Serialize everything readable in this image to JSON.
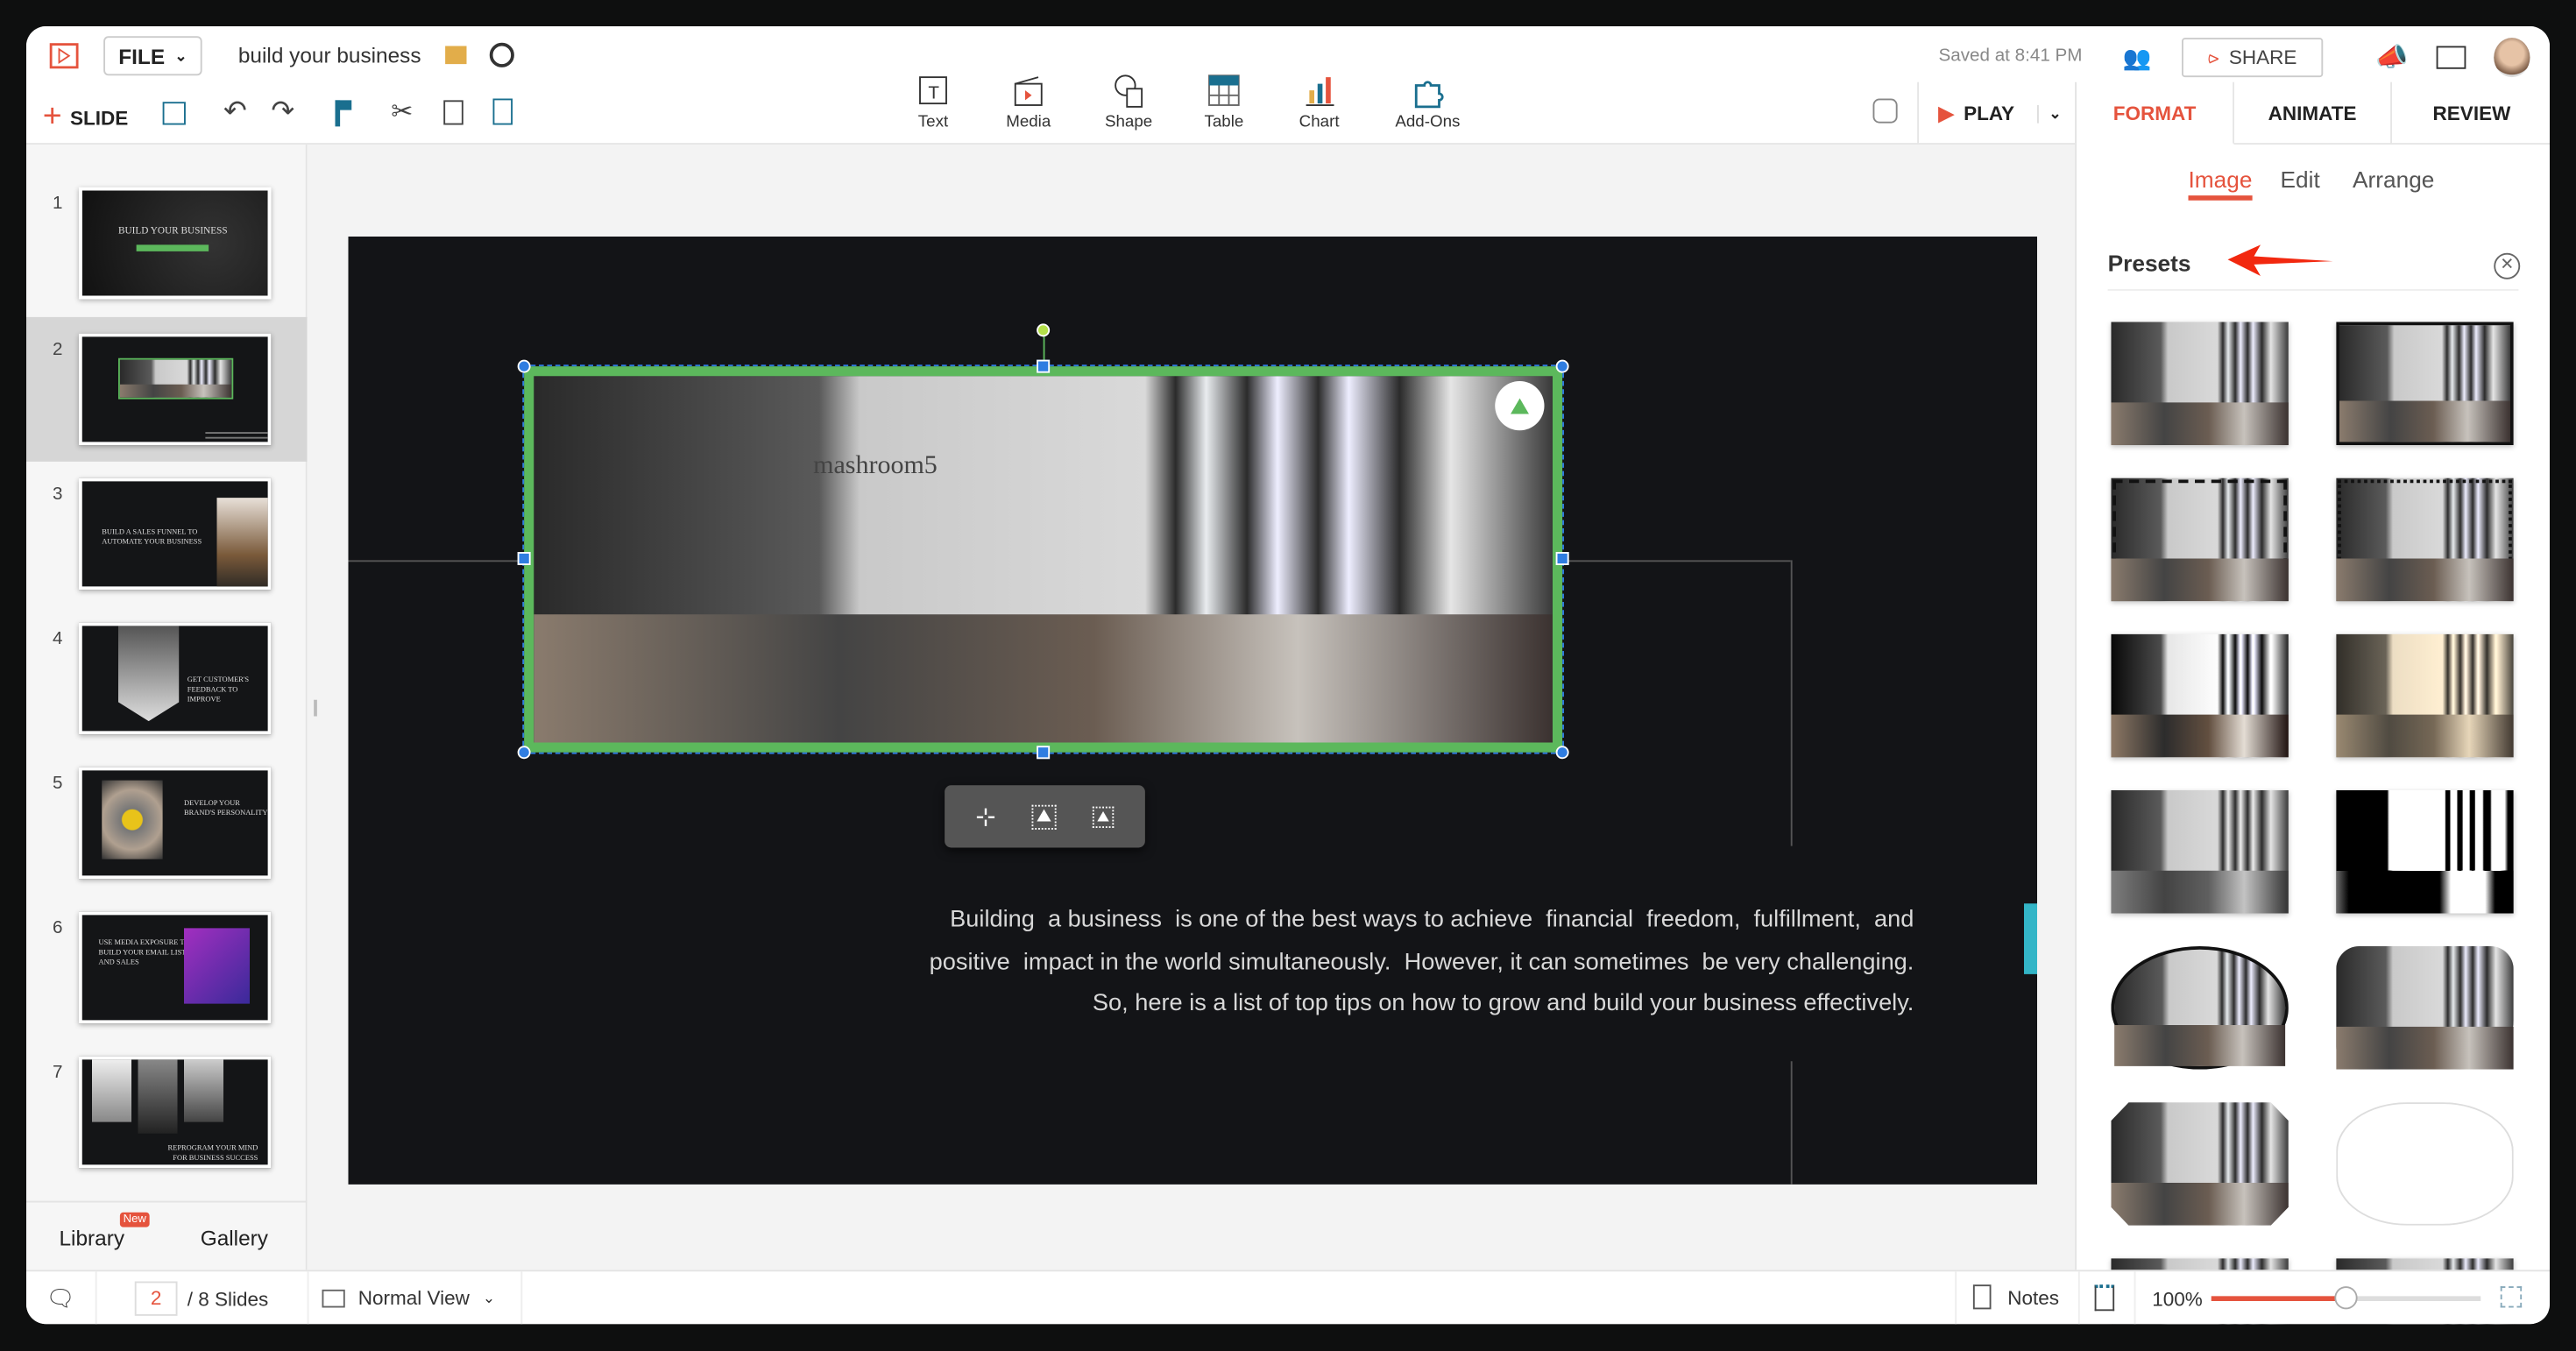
{
  "header": {
    "file_label": "FILE",
    "doc_title": "build your business",
    "saved_status": "Saved at 8:41 PM",
    "share_label": "SHARE",
    "add_slide_label": "SLIDE",
    "play_label": "PLAY"
  },
  "insert_tools": [
    {
      "label": "Text",
      "icon": "text-box-icon"
    },
    {
      "label": "Media",
      "icon": "clapperboard-icon"
    },
    {
      "label": "Shape",
      "icon": "shape-icon"
    },
    {
      "label": "Table",
      "icon": "table-icon"
    },
    {
      "label": "Chart",
      "icon": "bar-chart-icon"
    },
    {
      "label": "Add-Ons",
      "icon": "puzzle-icon"
    }
  ],
  "panel_tabs": [
    {
      "label": "FORMAT",
      "active": true
    },
    {
      "label": "ANIMATE"
    },
    {
      "label": "REVIEW"
    }
  ],
  "sub_tabs": [
    {
      "label": "Image",
      "active": true
    },
    {
      "label": "Edit"
    },
    {
      "label": "Arrange"
    }
  ],
  "presets_title": "Presets",
  "slides": [
    {
      "num": "1",
      "title": "BUILD YOUR BUSINESS"
    },
    {
      "num": "2",
      "title": ""
    },
    {
      "num": "3",
      "title": "BUILD A SALES FUNNEL TO AUTOMATE YOUR BUSINESS"
    },
    {
      "num": "4",
      "title": "GET CUSTOMER'S FEEDBACK TO IMPROVE"
    },
    {
      "num": "5",
      "title": "DEVELOP YOUR BRAND'S PERSONALITY"
    },
    {
      "num": "6",
      "title": "USE MEDIA EXPOSURE TO BUILD YOUR EMAIL LIST AND SALES"
    },
    {
      "num": "7",
      "title": "REPROGRAM YOUR MIND FOR BUSINESS SUCCESS"
    }
  ],
  "sidebar_footer": {
    "library": "Library",
    "new_badge": "New",
    "gallery": "Gallery"
  },
  "slide_content": {
    "image_sign": "mashroom5",
    "body_lines": [
      "Building  a business  is one of the best ways to achieve  financial  freedom,  fulfillment,  and",
      "positive  impact in the world simultaneously.  However, it can sometimes  be very challenging.",
      "So, here is a list of top tips on how to grow and build your business effectively."
    ]
  },
  "statusbar": {
    "current_slide": "2",
    "total_slides": "/ 8 Slides",
    "view_mode": "Normal View",
    "notes": "Notes",
    "zoom": "100%",
    "zoom_fraction": 0.5
  },
  "colors": {
    "accent": "#e5533d",
    "selection": "#5cb85c",
    "handle": "#2f7de1",
    "teal": "#33b5c7"
  }
}
